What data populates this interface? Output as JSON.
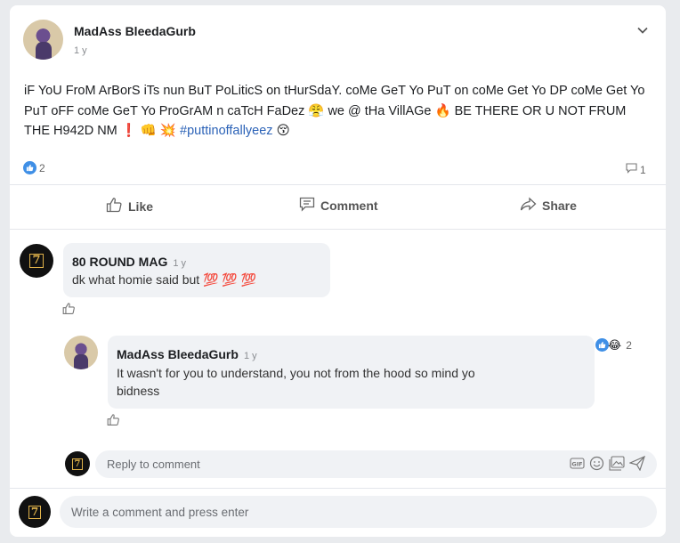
{
  "post": {
    "author": "MadAss BleedaGurb",
    "time": "1 y",
    "text_parts": {
      "line": "iF YoU FroM ArBorS iTs nun BuT PoLiticS on tHurSdaY. coMe GeT Yo PuT on coMe Get Yo DP coMe Get Yo PuT oFF coMe GeT Yo ProGrAM n caTcH FaDez 😤 we @ tHa VillAGe 🔥 BE THERE OR U NOT FRUM THE H942D NM ❗ 👊 💥",
      "hashtag": "#puttinoffallyeez",
      "emoji_end": "😚"
    },
    "reaction_count": "2",
    "comment_count": "1"
  },
  "actions": {
    "like": "Like",
    "comment": "Comment",
    "share": "Share"
  },
  "comments": [
    {
      "author": "80 ROUND MAG",
      "time": "1 y",
      "text": "dk what homie said but 💯 💯 💯",
      "avatar_mark": "7"
    }
  ],
  "reply": {
    "author": "MadAss BleedaGurb",
    "time": "1 y",
    "text": "It wasn't for you to understand, you not from the hood so mind yo bidness",
    "reaction_emoji": "😂",
    "reaction_count": "2"
  },
  "reply_input": {
    "placeholder": "Reply to comment",
    "avatar_mark": "7"
  },
  "comment_input": {
    "placeholder": "Write a comment and press enter",
    "avatar_mark": "7"
  },
  "colors": {
    "accent": "#3f8fe6",
    "hashtag": "#2b62b7",
    "background": "#e9ebee"
  },
  "icons": [
    "chevron-down-icon",
    "like-icon",
    "comment-icon",
    "share-icon",
    "gif-icon",
    "emoji-icon",
    "photo-icon",
    "send-icon"
  ]
}
